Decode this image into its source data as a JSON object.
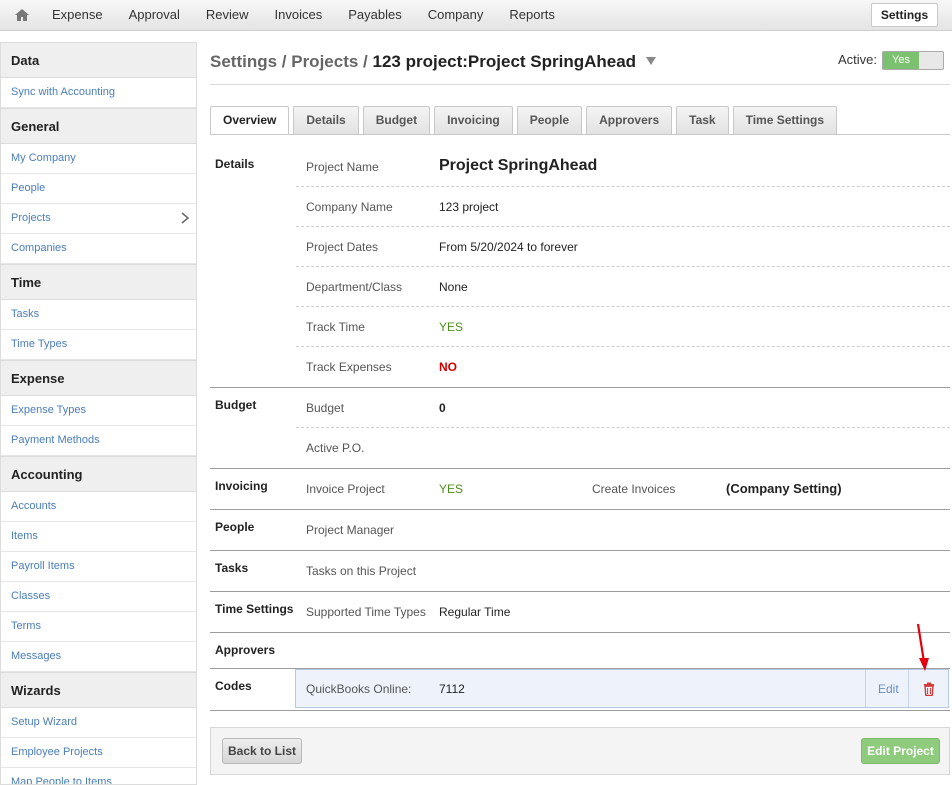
{
  "topnav": {
    "home_icon": "home-icon",
    "items": [
      "Expense",
      "Approval",
      "Review",
      "Invoices",
      "Payables",
      "Company",
      "Reports"
    ],
    "settings_label": "Settings"
  },
  "sidebar": {
    "sections": [
      {
        "title": "Data",
        "items": [
          "Sync with Accounting"
        ]
      },
      {
        "title": "General",
        "items": [
          "My Company",
          "People",
          "Projects",
          "Companies"
        ]
      },
      {
        "title": "Time",
        "items": [
          "Tasks",
          "Time Types"
        ]
      },
      {
        "title": "Expense",
        "items": [
          "Expense Types",
          "Payment Methods"
        ]
      },
      {
        "title": "Accounting",
        "items": [
          "Accounts",
          "Items",
          "Payroll Items",
          "Classes",
          "Terms",
          "Messages"
        ]
      },
      {
        "title": "Wizards",
        "items": [
          "Setup Wizard",
          "Employee Projects",
          "Map People to Items"
        ]
      }
    ],
    "active_item": "Projects"
  },
  "header": {
    "crumb": "Settings / Projects / ",
    "title": "123 project:Project SpringAhead",
    "active_label": "Active:",
    "active_value": "Yes"
  },
  "tabs": [
    "Overview",
    "Details",
    "Budget",
    "Invoicing",
    "People",
    "Approvers",
    "Task",
    "Time Settings"
  ],
  "active_tab": "Overview",
  "details": {
    "section": "Details",
    "project_name_label": "Project Name",
    "project_name": "Project SpringAhead",
    "company_name_label": "Company Name",
    "company_name": "123 project",
    "project_dates_label": "Project Dates",
    "project_dates": "From 5/20/2024 to forever",
    "department_label": "Department/Class",
    "department": "None",
    "track_time_label": "Track Time",
    "track_time": "YES",
    "track_expenses_label": "Track Expenses",
    "track_expenses": "NO"
  },
  "budget": {
    "section": "Budget",
    "budget_label": "Budget",
    "budget_value": "0",
    "active_po_label": "Active P.O."
  },
  "invoicing": {
    "section": "Invoicing",
    "invoice_project_label": "Invoice Project",
    "invoice_project": "YES",
    "create_invoices_label": "Create Invoices",
    "create_invoices": "(Company Setting)"
  },
  "people": {
    "section": "People",
    "manager_label": "Project Manager"
  },
  "tasks": {
    "section": "Tasks",
    "tasks_label": "Tasks on this Project"
  },
  "time_settings": {
    "section": "Time Settings",
    "supported_label": "Supported Time Types",
    "supported_value": "Regular Time"
  },
  "approvers": {
    "section": "Approvers"
  },
  "codes": {
    "section": "Codes",
    "source_label": "QuickBooks Online:",
    "code_value": "7112",
    "edit_label": "Edit",
    "delete_icon": "trash-icon"
  },
  "footer": {
    "back_label": "Back to List",
    "edit_label": "Edit Project"
  },
  "colors": {
    "yes": "#4f8f1e",
    "no": "#d40000",
    "toggle_green": "#7cc16f",
    "edit_project_button": "#8fcb7d",
    "annotation_arrow": "#e3000f"
  }
}
